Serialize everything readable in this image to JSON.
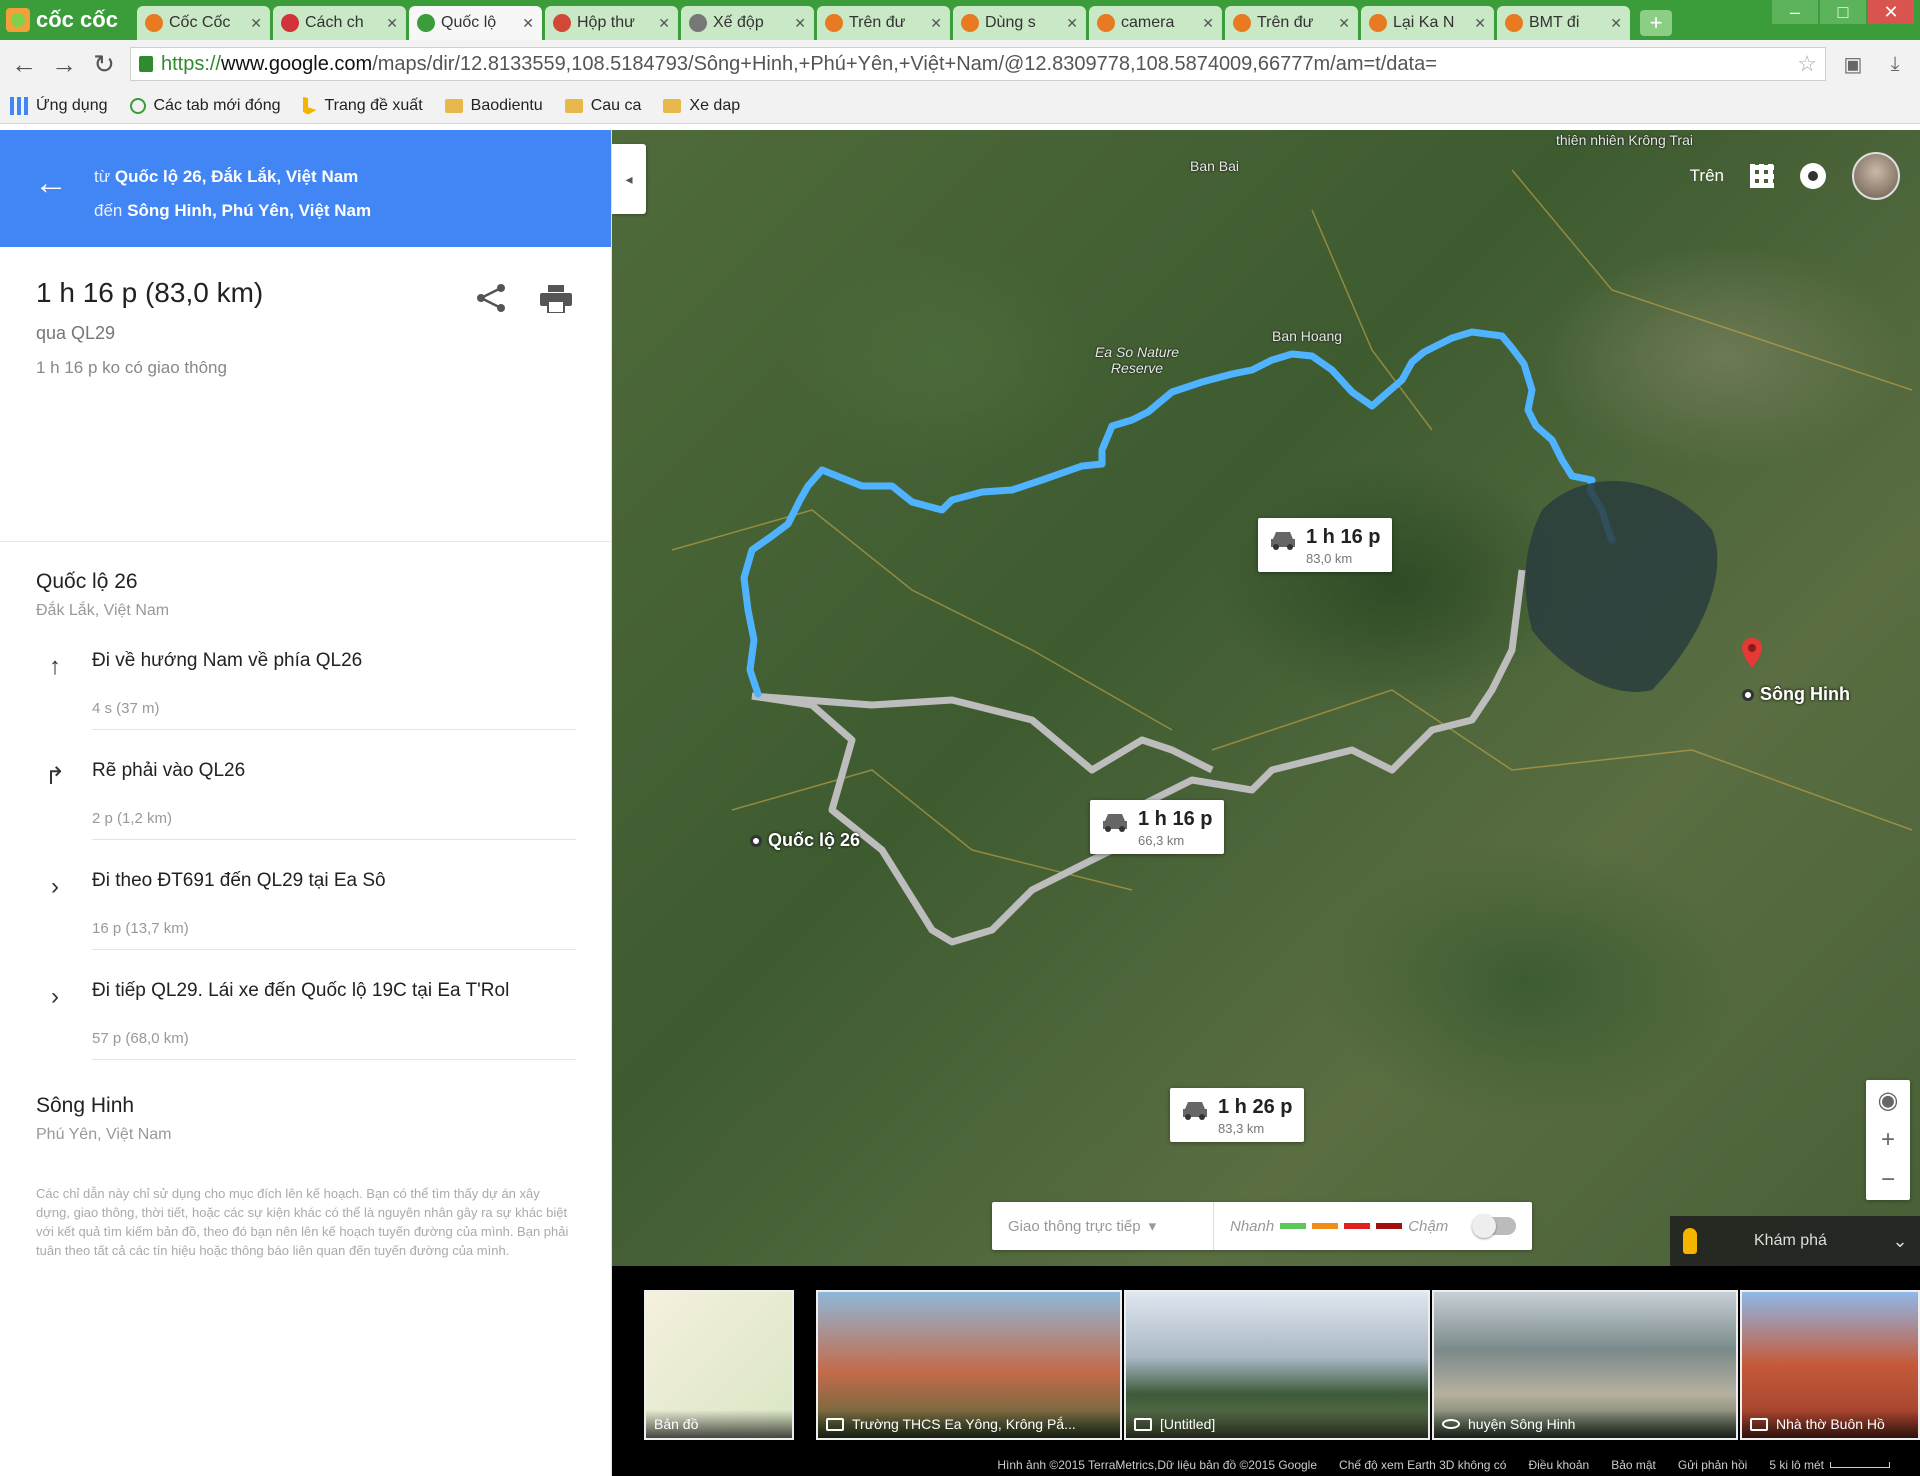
{
  "browser": {
    "brand": "cốc cốc",
    "tabs": [
      {
        "label": "Cốc Cốc",
        "active": false,
        "color": "#e87a22"
      },
      {
        "label": "Cách ch",
        "active": false,
        "color": "#d0333a"
      },
      {
        "label": "Quốc lộ",
        "active": true,
        "color": "#3a9d3a"
      },
      {
        "label": "Hộp thư",
        "active": false,
        "color": "#d14836"
      },
      {
        "label": "Xế độp",
        "active": false,
        "color": "#777777"
      },
      {
        "label": "Trên đư",
        "active": false,
        "color": "#e87a22"
      },
      {
        "label": "Dùng s",
        "active": false,
        "color": "#e87a22"
      },
      {
        "label": "camera",
        "active": false,
        "color": "#e87a22"
      },
      {
        "label": "Trên đư",
        "active": false,
        "color": "#e87a22"
      },
      {
        "label": "Lại Ka N",
        "active": false,
        "color": "#e87a22"
      },
      {
        "label": "BMT đi",
        "active": false,
        "color": "#e87a22"
      }
    ],
    "url_scheme": "https://",
    "url_host": "www.google.com",
    "url_path": "/maps/dir/12.8133559,108.5184793/Sông+Hinh,+Phú+Yên,+Việt+Nam/@12.8309778,108.5874009,66777m/am=t/data=",
    "bookmarks": [
      {
        "label": "Ứng dụng",
        "icon": "apps-icon"
      },
      {
        "label": "Các tab mới đóng",
        "icon": "history-icon"
      },
      {
        "label": "Trang đề xuất",
        "icon": "bing-icon"
      },
      {
        "label": "Baodientu",
        "icon": "folder-icon"
      },
      {
        "label": "Cau ca",
        "icon": "folder-icon"
      },
      {
        "label": "Xe dap",
        "icon": "folder-icon"
      }
    ]
  },
  "directions": {
    "from_prefix": "từ",
    "from": "Quốc lộ 26, Đắk Lắk, Việt Nam",
    "to_prefix": "đến",
    "to": "Sông Hinh, Phú Yên, Việt Nam",
    "summary": {
      "duration": "1 h 16 p (83,0 km)",
      "via": "qua QL29",
      "traffic": "1 h 16 p ko có giao thông"
    },
    "start": {
      "title": "Quốc lộ 26",
      "subtitle": "Đắk Lắk, Việt Nam"
    },
    "steps": [
      {
        "icon": "arrow-up-icon",
        "glyph": "↑",
        "text": "Đi về hướng Nam về phía QL26",
        "meta": "4 s (37 m)"
      },
      {
        "icon": "turn-right-icon",
        "glyph": "↱",
        "text": "Rẽ phải vào QL26",
        "meta": "2 p (1,2 km)"
      },
      {
        "icon": "chevron-right-icon",
        "glyph": "›",
        "text": "Đi theo ĐT691 đến QL29 tại Ea Sô",
        "meta": "16 p (13,7 km)"
      },
      {
        "icon": "chevron-right-icon",
        "glyph": "›",
        "text": "Đi tiếp QL29. Lái xe đến Quốc lộ 19C tại Ea T'Rol",
        "meta": "57 p (68,0 km)"
      }
    ],
    "end": {
      "title": "Sông Hinh",
      "subtitle": "Phú Yên, Việt Nam"
    },
    "disclaimer": "Các chỉ dẫn này chỉ sử dụng cho mục đích lên kế hoạch. Bạn có thể tìm thấy dự án xây dựng, giao thông, thời tiết, hoặc các sự kiện khác có thể là nguyên nhân gây ra sự khác biệt với kết quả tìm kiếm bản đồ, theo đó bạn nên lên kế hoạch tuyến đường của mình. Bạn phải tuân theo tất cả các tín hiệu hoặc thông báo liên quan đến tuyến đường của mình."
  },
  "map": {
    "top_right_label": "Trên",
    "labels": [
      {
        "text": "thiên nhiên Krông Trai"
      },
      {
        "text": "Ban Bai"
      },
      {
        "text": "Ban Hoang"
      },
      {
        "text": "Ea So Nature Reserve"
      }
    ],
    "route_cards": [
      {
        "time": "1 h 16 p",
        "dist": "83,0 km",
        "selected": true
      },
      {
        "time": "1 h 16 p",
        "dist": "66,3 km",
        "selected": false
      },
      {
        "time": "1 h 26 p",
        "dist": "83,3 km",
        "selected": false
      }
    ],
    "origin_label": "Quốc lộ 26",
    "destination_label": "Sông Hinh",
    "traffic": {
      "live_label": "Giao thông trực tiếp",
      "fast": "Nhanh",
      "slow": "Chậm",
      "colors": [
        "#5cc85c",
        "#f28c18",
        "#e02020",
        "#a01010"
      ]
    },
    "explore_label": "Khám phá",
    "route_color": "#4fb3ff",
    "alt_route_color": "#b8b8b8"
  },
  "imagery": {
    "thumbs": [
      {
        "caption": "Bản đồ",
        "icon": ""
      },
      {
        "caption": "Trường THCS Ea Yông, Krông Pắ...",
        "icon": "camera-icon"
      },
      {
        "caption": "[Untitled]",
        "icon": "camera-icon"
      },
      {
        "caption": "huyện Sông Hinh",
        "icon": "pano-icon"
      },
      {
        "caption": "Nhà thờ Buôn Hồ",
        "icon": "camera-icon"
      }
    ],
    "footer": [
      "Hình ảnh ©2015 TerraMetrics,Dữ liệu bản đồ ©2015 Google",
      "Chế độ xem Earth 3D không có",
      "Điều khoản",
      "Bảo mật",
      "Gửi phản hồi"
    ],
    "scale": "5 ki lô mét"
  }
}
